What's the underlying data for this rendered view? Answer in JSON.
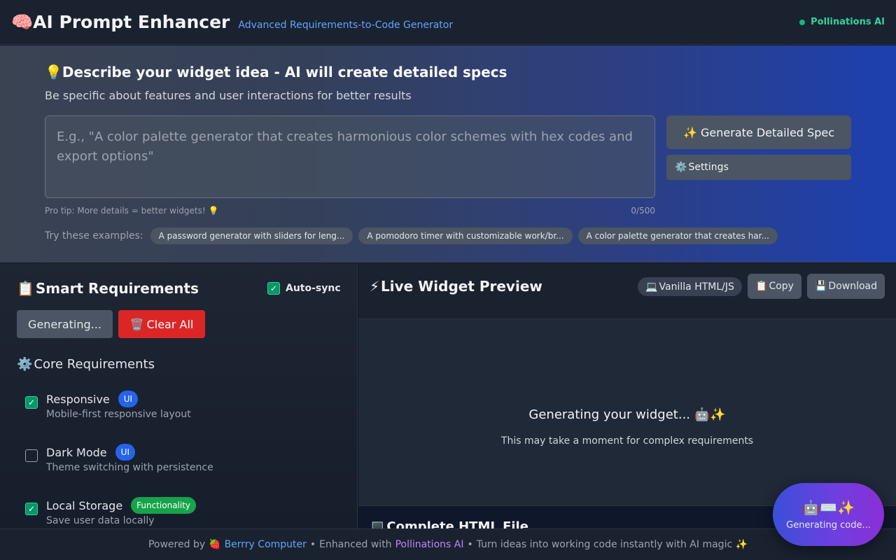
{
  "header": {
    "icon": "🧠",
    "title": "AI Prompt Enhancer",
    "subtitle": "Advanced Requirements-to-Code Generator",
    "status": "Pollinations AI",
    "status_color": "#10b981"
  },
  "hero": {
    "icon": "💡",
    "title": "Describe your widget idea - AI will create detailed specs",
    "description": "Be specific about features and user interactions for better results",
    "input_placeholder": "E.g., \"A color palette generator that creates harmonious color schemes with hex codes and export options\"",
    "input_value": "",
    "generate_button": "✨ Generate Detailed Spec",
    "settings_icon": "⚙️",
    "settings_button": "Settings",
    "pro_tip": "Pro tip: More details = better widgets! 💡",
    "char_count": "0/500",
    "examples_label": "Try these examples:",
    "examples": [
      "A password generator with sliders for leng...",
      "A pomodoro timer with customizable work/br...",
      "A color palette generator that creates har..."
    ]
  },
  "requirements": {
    "icon": "📋",
    "title": "Smart Requirements",
    "autosync_label": "Auto-sync",
    "autosync_checked": true,
    "generating_button": "Generating...",
    "clear_icon": "🗑️",
    "clear_button": "Clear All",
    "section_icon": "⚙️",
    "section_title": "Core Requirements",
    "items": [
      {
        "name": "Responsive",
        "tag": "UI",
        "desc": "Mobile-first responsive layout",
        "checked": true
      },
      {
        "name": "Dark Mode",
        "tag": "UI",
        "desc": "Theme switching with persistence",
        "checked": false
      },
      {
        "name": "Local Storage",
        "tag": "Functionality",
        "desc": "Save user data locally",
        "checked": true
      }
    ]
  },
  "preview": {
    "icon": "⚡",
    "title": "Live Widget Preview",
    "framework_icon": "💻",
    "framework": "Vanilla HTML/JS",
    "copy_icon": "📋",
    "copy_button": "Copy",
    "download_icon": "💾",
    "download_button": "Download",
    "status_main": "Generating your widget... 🤖✨",
    "status_sub": "This may take a moment for complex requirements",
    "html_file_icon": "💻",
    "html_file_title": "Complete HTML File"
  },
  "bubble": {
    "icons": "🤖⌨️✨",
    "text": "Generating code..."
  },
  "footer": {
    "powered_by": "Powered by",
    "berry_icon": "🍓",
    "berry_link": "Berrry Computer",
    "sep1": "•",
    "enhanced_with": "Enhanced with",
    "pollinations_link": "Pollinations AI",
    "sep2": "•",
    "tagline": "Turn ideas into working code instantly with AI magic ✨"
  },
  "colors": {
    "accent_blue": "#2563eb",
    "danger_red": "#dc2626",
    "success_green": "#16a34a",
    "link_blue": "#60a5fa",
    "link_purple": "#c084fc"
  }
}
